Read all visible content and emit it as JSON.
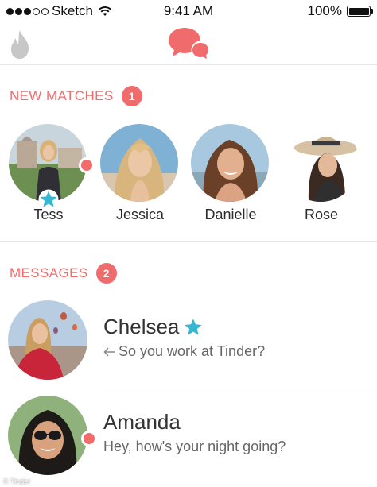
{
  "status_bar": {
    "carrier": "Sketch",
    "time": "9:41 AM",
    "battery": "100%",
    "battery_level": 1.0
  },
  "nav": {
    "left_icon": "flame-icon",
    "center_icon": "chat-bubbles-icon"
  },
  "new_matches": {
    "title": "NEW MATCHES",
    "count": "1",
    "items": [
      {
        "name": "Tess",
        "unread": true,
        "super_like": true
      },
      {
        "name": "Jessica",
        "unread": false,
        "super_like": false
      },
      {
        "name": "Danielle",
        "unread": false,
        "super_like": false
      },
      {
        "name": "Rose",
        "unread": false,
        "super_like": false
      }
    ]
  },
  "messages": {
    "title": "MESSAGES",
    "count": "2",
    "items": [
      {
        "name": "Chelsea",
        "preview": "So you work at Tinder?",
        "replied": true,
        "super_like": true,
        "unread": false
      },
      {
        "name": "Amanda",
        "preview": "Hey, how's your night going?",
        "replied": false,
        "super_like": false,
        "unread": true
      }
    ]
  },
  "watermark": "© Tinder",
  "colors": {
    "accent": "#f06b6b",
    "super_like": "#35b6d1",
    "flame_inactive": "#c7c7c7"
  }
}
